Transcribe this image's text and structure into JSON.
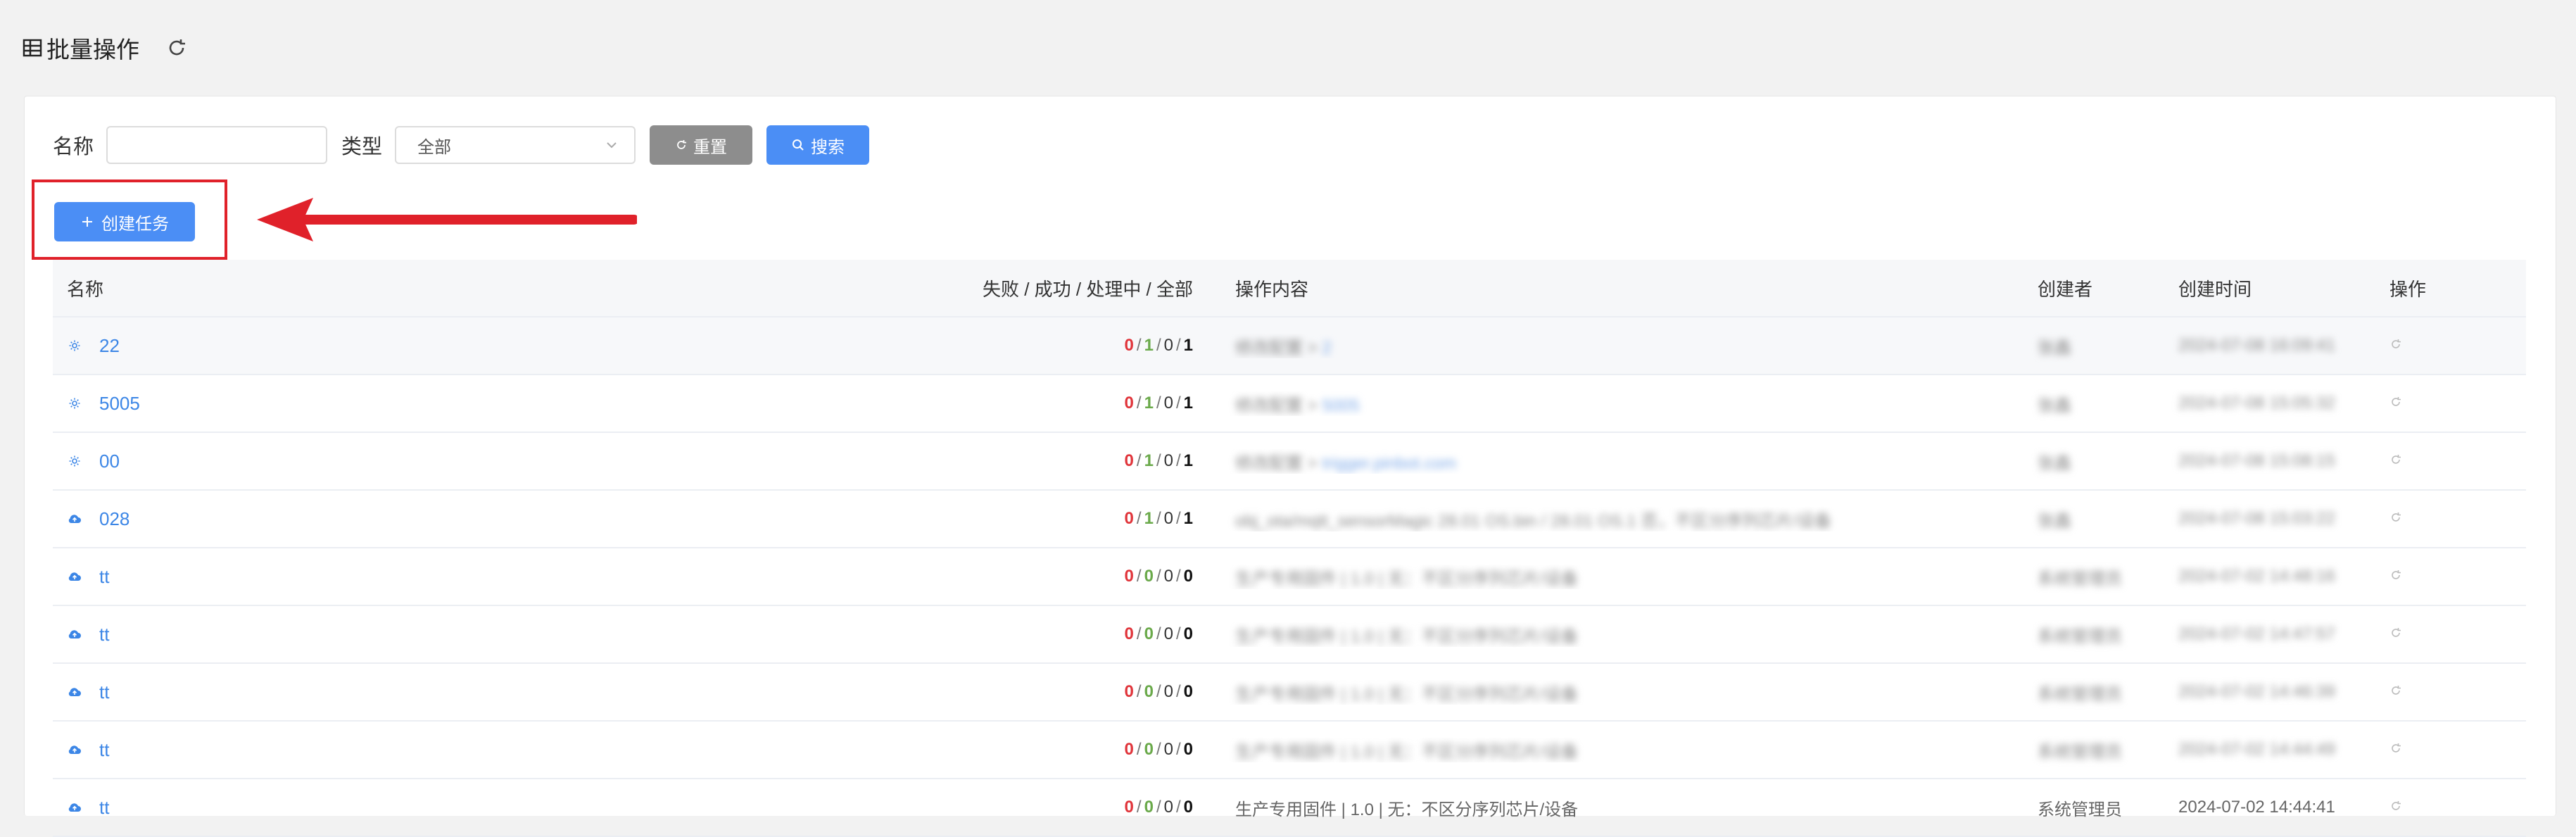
{
  "page": {
    "title": "批量操作"
  },
  "filters": {
    "name_label": "名称",
    "name_value": "",
    "type_label": "类型",
    "type_selected": "全部",
    "reset_label": "重置",
    "search_label": "搜索"
  },
  "create": {
    "label": "创建任务"
  },
  "annotation": {
    "highlight_color": "#e0212a"
  },
  "table": {
    "headers": {
      "name": "名称",
      "stats": "失败 / 成功 / 处理中 / 全部",
      "content": "操作内容",
      "creator": "创建者",
      "time": "创建时间",
      "action": "操作"
    },
    "rows": [
      {
        "icon": "gear-icon",
        "name": "22",
        "fail": "0",
        "success": "1",
        "processing": "0",
        "total": "1",
        "content_text": "修改配置 > ",
        "content_link": "2",
        "creator": "张鑫",
        "time": "2024-07-08 16:09:41"
      },
      {
        "icon": "gear-icon",
        "name": "5005",
        "fail": "0",
        "success": "1",
        "processing": "0",
        "total": "1",
        "content_text": "修改配置 > ",
        "content_link": "5005",
        "creator": "张鑫",
        "time": "2024-07-08 15:05:32"
      },
      {
        "icon": "gear-icon",
        "name": "00",
        "fail": "0",
        "success": "1",
        "processing": "0",
        "total": "1",
        "content_text": "修改配置 > ",
        "content_link": "trigger.pinbot.com",
        "creator": "张鑫",
        "time": "2024-07-08 15:08:15"
      },
      {
        "icon": "cloud-upload-icon",
        "name": "028",
        "fail": "0",
        "success": "1",
        "processing": "0",
        "total": "1",
        "content_text": "obj_ota/mqtt_sensorMagic 28.01 OS.bin / 28.01 OS.1 否，不区分序列芯片/设备",
        "content_link": "",
        "creator": "张鑫",
        "time": "2024-07-08 15:03:22"
      },
      {
        "icon": "cloud-upload-icon",
        "name": "tt",
        "fail": "0",
        "success": "0",
        "processing": "0",
        "total": "0",
        "content_text": "生产专用固件 | 1.0 | 无：不区分序列芯片/设备",
        "content_link": "",
        "creator": "系统管理员",
        "time": "2024-07-02 14:48:16"
      },
      {
        "icon": "cloud-upload-icon",
        "name": "tt",
        "fail": "0",
        "success": "0",
        "processing": "0",
        "total": "0",
        "content_text": "生产专用固件 | 1.0 | 无：不区分序列芯片/设备",
        "content_link": "",
        "creator": "系统管理员",
        "time": "2024-07-02 14:47:57"
      },
      {
        "icon": "cloud-upload-icon",
        "name": "tt",
        "fail": "0",
        "success": "0",
        "processing": "0",
        "total": "0",
        "content_text": "生产专用固件 | 1.0 | 无：不区分序列芯片/设备",
        "content_link": "",
        "creator": "系统管理员",
        "time": "2024-07-02 14:46:39"
      },
      {
        "icon": "cloud-upload-icon",
        "name": "tt",
        "fail": "0",
        "success": "0",
        "processing": "0",
        "total": "0",
        "content_text": "生产专用固件 | 1.0 | 无：不区分序列芯片/设备",
        "content_link": "",
        "creator": "系统管理员",
        "time": "2024-07-02 14:44:49"
      },
      {
        "icon": "cloud-upload-icon",
        "name": "tt",
        "fail": "0",
        "success": "0",
        "processing": "0",
        "total": "0",
        "content_text": "生产专用固件 | 1.0 | 无：不区分序列芯片/设备",
        "content_link": "",
        "creator": "系统管理员",
        "time": "2024-07-02 14:44:41"
      }
    ]
  }
}
